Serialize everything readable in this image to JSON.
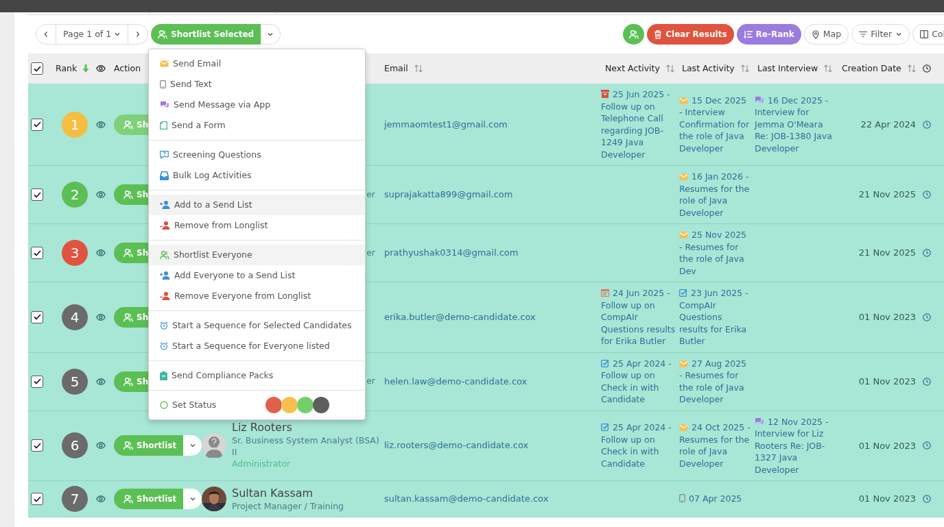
{
  "toolbar": {
    "page_label": "Page 1 of 1",
    "shortlist_button": "Shortlist Selected",
    "actions": [
      {
        "kind": "shortlist-all"
      },
      {
        "kind": "clear",
        "label": "Clear Results"
      },
      {
        "kind": "rerank",
        "label": "Re-Rank"
      },
      {
        "kind": "map",
        "label": "Map"
      },
      {
        "kind": "filter",
        "label": "Filter"
      },
      {
        "kind": "columns",
        "label": "Col"
      }
    ]
  },
  "table": {
    "header": {
      "checked": true,
      "rank": "Rank",
      "action": "Action",
      "email": "Email",
      "next_activity": "Next Activity",
      "last_activity": "Last Activity",
      "last_interview": "Last Interview",
      "creation_date": "Creation Date"
    },
    "rows": [
      {
        "checked": true,
        "rank": "1",
        "color": "#f5bd41",
        "action": "Sh",
        "dimmed": true,
        "menu_caret": false,
        "email": "jemmaomtest1@gmail.com",
        "next_activity": {
          "kind": "archive",
          "text": "25 Jun 2025 - Follow up on Telephone Call regarding JOB-1249 Java Developer"
        },
        "last_activity": {
          "kind": "email",
          "text": "15 Dec 2025 - Interview Confirmation for the role of Java Developer"
        },
        "last_interview": {
          "kind": "chat",
          "text": "16 Dec 2025 - Interview for Jemma O'Meara Re: JOB-1380 Java Developer"
        },
        "creation_date": "22 Apr 2024"
      },
      {
        "checked": true,
        "rank": "2",
        "color": "#5cbf55",
        "action": "Sh",
        "dimmed": false,
        "menu_caret": false,
        "person": {
          "fragment": "er"
        },
        "email": "suprajakatta899@gmail.com",
        "last_activity": {
          "kind": "email",
          "text": "16 Jan 2026 - Resumes for the role of Java Developer"
        },
        "creation_date": "21 Nov 2025"
      },
      {
        "checked": true,
        "rank": "3",
        "color": "#e0533f",
        "action": "Sh",
        "dimmed": false,
        "menu_caret": false,
        "person": {
          "fragment": "er"
        },
        "email": "prathyushak0314@gmail.com",
        "last_activity": {
          "kind": "email",
          "text": "25 Nov 2025 - Resumes for the role of Java Dev"
        },
        "creation_date": "21 Nov 2025"
      },
      {
        "checked": true,
        "rank": "4",
        "color": "#6b6b6b",
        "action": "Sh",
        "dimmed": false,
        "menu_caret": false,
        "email": "erika.butler@demo-candidate.cox",
        "next_activity": {
          "kind": "calendar",
          "text": "24 Jun 2025 - Follow up on CompAIr Questions results for Erika Butler"
        },
        "last_activity": {
          "kind": "task",
          "text": "23 Jun 2025 - CompAIr Questions results for Erika Butler"
        },
        "creation_date": "01 Nov 2023"
      },
      {
        "checked": true,
        "rank": "5",
        "color": "#6b6b6b",
        "action": "Sh",
        "dimmed": false,
        "menu_caret": false,
        "person": {
          "fragment": "er"
        },
        "email": "helen.law@demo-candidate.cox",
        "next_activity": {
          "kind": "task",
          "text": "25 Apr 2024 - Follow up on Check in with Candidate"
        },
        "last_activity": {
          "kind": "email",
          "text": "27 Aug 2025 - Resumes for the role of Java Developer"
        },
        "creation_date": "01 Nov 2023"
      },
      {
        "checked": true,
        "rank": "6",
        "color": "#6b6b6b",
        "action": "Shortlist",
        "dimmed": false,
        "menu_caret": true,
        "person": {
          "has_photo": false,
          "name": "Liz Rooters",
          "role": "Sr. Business System Analyst (BSA) II",
          "company": "Administrator"
        },
        "email": "liz.rooters@demo-candidate.cox",
        "next_activity": {
          "kind": "task",
          "text": "25 Apr 2024 - Follow up on Check in with Candidate"
        },
        "last_activity": {
          "kind": "email",
          "text": "24 Oct 2025 - Resumes for the role of Java Developer"
        },
        "last_interview": {
          "kind": "chat",
          "text": "12 Nov 2025 - Interview for Liz Rooters Re: JOB-1327 Java Developer"
        },
        "creation_date": "01 Nov 2023"
      },
      {
        "checked": true,
        "rank": "7",
        "color": "#6b6b6b",
        "action": "Shortlist",
        "dimmed": false,
        "menu_caret": true,
        "person": {
          "has_photo": true,
          "name": "Sultan Kassam",
          "role": "Project Manager / Training"
        },
        "email": "sultan.kassam@demo-candidate.cox",
        "last_activity": {
          "kind": "phone",
          "text": "07 Apr 2025"
        },
        "creation_date": "01 Nov 2023"
      }
    ]
  },
  "menu": {
    "sections": [
      [
        {
          "kind": "email",
          "label": "Send Email",
          "highlighted": false
        },
        {
          "kind": "phone",
          "label": "Send Text",
          "highlighted": false
        },
        {
          "kind": "chat",
          "label": "Send Message via App",
          "highlighted": false
        },
        {
          "kind": "form",
          "label": "Send a Form",
          "highlighted": false
        }
      ],
      [
        {
          "kind": "question",
          "label": "Screening Questions",
          "highlighted": false
        },
        {
          "kind": "inbox",
          "label": "Bulk Log Activities",
          "highlighted": false
        }
      ],
      [
        {
          "kind": "add-user",
          "label": "Add to a Send List",
          "highlighted": true
        },
        {
          "kind": "remove-user",
          "label": "Remove from Longlist",
          "highlighted": false
        }
      ],
      [
        {
          "kind": "shortlist",
          "label": "Shortlist Everyone",
          "highlighted": true
        },
        {
          "kind": "add-user",
          "label": "Add Everyone to a Send List",
          "highlighted": false
        },
        {
          "kind": "remove-user",
          "label": "Remove Everyone from Longlist",
          "highlighted": false
        }
      ],
      [
        {
          "kind": "alarm",
          "label": "Start a Sequence for Selected Candidates",
          "highlighted": false
        },
        {
          "kind": "alarm",
          "label": "Start a Sequence for Everyone listed",
          "highlighted": false
        }
      ],
      [
        {
          "kind": "clipboard",
          "label": "Send Compliance Packs",
          "highlighted": false
        }
      ],
      [
        {
          "kind": "status",
          "label": "Set Status",
          "highlighted": false,
          "statuses": [
            {
              "color": "#e0604c"
            },
            {
              "color": "#f5c04e"
            },
            {
              "color": "#72cf6a"
            },
            {
              "color": "#5e5e5e"
            }
          ]
        }
      ]
    ]
  }
}
